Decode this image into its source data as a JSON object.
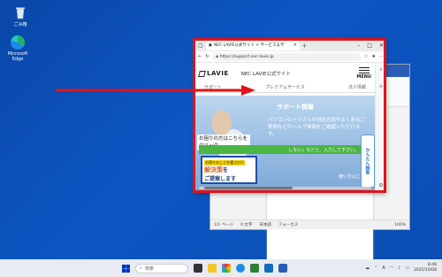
{
  "desktop": {
    "recycle_bin": "ごみ箱",
    "edge": "Microsoft Edge"
  },
  "browser": {
    "tab_title": "NEC LAVIE公式サイト > サービス＆サ",
    "url": "https://support.nec-lavie.jp",
    "logo": "LAVIE",
    "site_name": "NEC LAVIE公式サイト",
    "menu_label": "MENU",
    "nav": [
      "サポート",
      "プレミアムサービス",
      "法人情報"
    ],
    "hero_title": "サポート情報",
    "hero_body": "パソコンのトラブルの対処方法やよくあるご質問などのヘルプ情報をご確認いただけます。",
    "trouble": "お困りの方はこちらをクリック",
    "green_bar": "しない」などと、入力して下さい。",
    "banner_line1": "お困りのことを選ぶだけ",
    "banner_line2": "解決策",
    "banner_line3": "ご提案します",
    "banner_suffix": "を",
    "howto": "使い方はこちら",
    "float_tab": "かんたん検索"
  },
  "word": {
    "status_page": "1/1 ページ",
    "status_chars": "0 文字",
    "status_lang": "日本語",
    "status_focus": "フォーカス",
    "status_zoom": "100%"
  },
  "taskbar": {
    "search_placeholder": "検索",
    "ime": "A",
    "time": "8:48",
    "date": "2025/10/08"
  }
}
